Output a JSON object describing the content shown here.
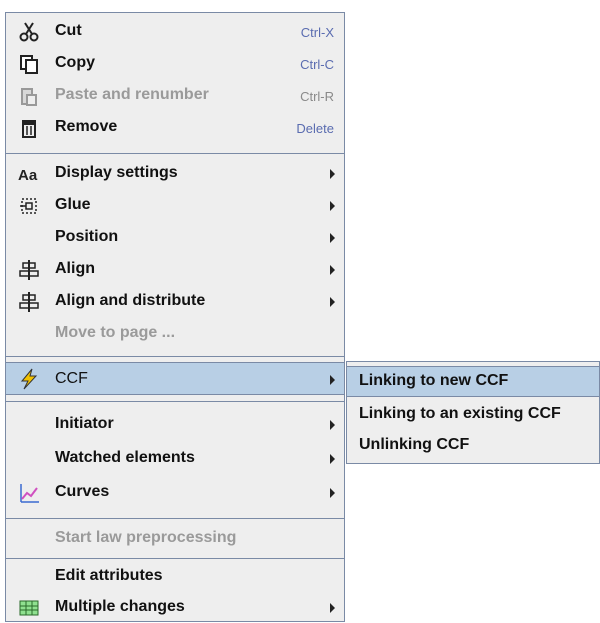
{
  "menu": {
    "items": [
      {
        "label": "Cut",
        "shortcut": "Ctrl-X",
        "icon": "scissors-icon"
      },
      {
        "label": "Copy",
        "shortcut": "Ctrl-C",
        "icon": "copy-icon"
      },
      {
        "label": "Paste and renumber",
        "shortcut": "Ctrl-R",
        "icon": "paste-icon",
        "disabled": true
      },
      {
        "label": "Remove",
        "shortcut": "Delete",
        "icon": "trash-icon"
      },
      {
        "label": "Display settings",
        "icon": "font-icon",
        "submenu": true
      },
      {
        "label": "Glue",
        "icon": "glue-icon",
        "submenu": true
      },
      {
        "label": "Position",
        "submenu": true
      },
      {
        "label": "Align",
        "icon": "align-icon",
        "submenu": true
      },
      {
        "label": "Align and distribute",
        "icon": "align-distribute-icon",
        "submenu": true
      },
      {
        "label": "Move to page ...",
        "disabled": true
      },
      {
        "label": "CCF",
        "icon": "lightning-icon",
        "submenu": true,
        "selected": true
      },
      {
        "label": "Initiator",
        "submenu": true
      },
      {
        "label": "Watched elements",
        "submenu": true
      },
      {
        "label": "Curves",
        "icon": "chart-icon",
        "submenu": true
      },
      {
        "label": "Start law preprocessing",
        "disabled": true
      },
      {
        "label": "Edit attributes"
      },
      {
        "label": "Multiple changes",
        "icon": "grid-icon",
        "submenu": true
      }
    ],
    "ccf_submenu": [
      {
        "label": "Linking to new CCF",
        "selected": true
      },
      {
        "label": "Linking to an existing CCF"
      },
      {
        "label": "Unlinking CCF"
      }
    ]
  },
  "colors": {
    "menu_bg": "#eeeeee",
    "border": "#7a8aa5",
    "selection": "#b8cfe5",
    "shortcut": "#5a6cb0",
    "disabled": "#9a9a9a"
  }
}
